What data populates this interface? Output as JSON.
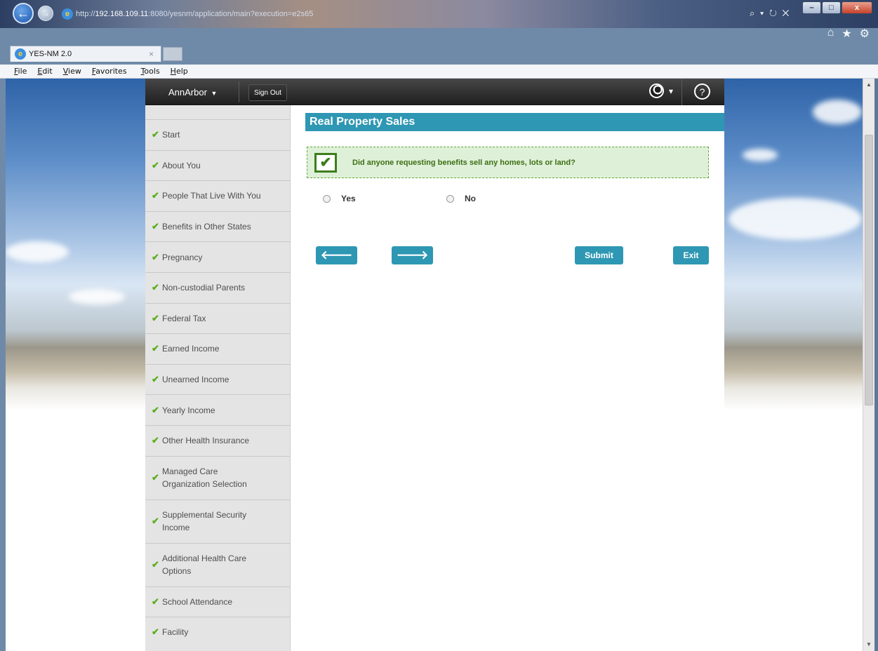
{
  "browser": {
    "url_scheme": "http://",
    "url_host": "192.168.109.11",
    "url_rest": ":8080/yesnm/application/main?execution=e2s65",
    "tab_title": "YES-NM 2.0",
    "tab_close": "×",
    "window_controls": [
      "–",
      "□",
      "x"
    ],
    "address_tools": "⌕ ▾ ↻ ✕",
    "menus": [
      "File",
      "Edit",
      "View",
      "Favorites",
      "Tools",
      "Help"
    ]
  },
  "header": {
    "user": "AnnArbor",
    "signout": "Sign Out"
  },
  "sidebar": {
    "items": [
      {
        "label": "Start"
      },
      {
        "label": "About You"
      },
      {
        "label": "People That Live With You"
      },
      {
        "label": "Benefits in Other States"
      },
      {
        "label": "Pregnancy"
      },
      {
        "label": "Non-custodial Parents"
      },
      {
        "label": "Federal Tax"
      },
      {
        "label": "Earned Income"
      },
      {
        "label": "Unearned Income"
      },
      {
        "label": "Yearly Income"
      },
      {
        "label": "Other Health Insurance"
      },
      {
        "label": "Managed Care Organization Selection"
      },
      {
        "label": "Supplemental Security Income"
      },
      {
        "label": "Additional Health Care Options"
      },
      {
        "label": "School Attendance"
      },
      {
        "label": "Facility"
      }
    ]
  },
  "main": {
    "title": "Real Property Sales",
    "question": "Did anyone requesting benefits sell any homes, lots or land?",
    "options": [
      "Yes",
      "No"
    ],
    "back_arrow": "🡐",
    "next_arrow": "🡒",
    "submit": "Submit",
    "exit": "Exit"
  }
}
